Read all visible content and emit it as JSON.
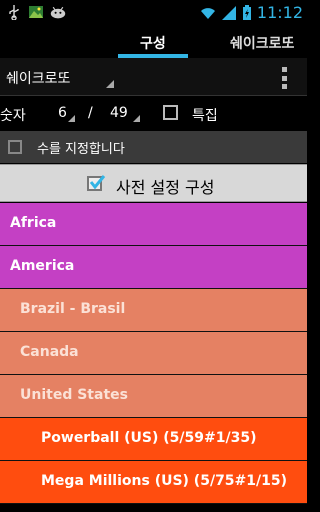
{
  "status_bar": {
    "time": "11:12",
    "left_icons": [
      "usb-icon",
      "image-icon",
      "android-icon"
    ],
    "right_icons": [
      "wifi-icon",
      "signal-icon",
      "battery-icon"
    ]
  },
  "tabs": [
    {
      "label": "구성",
      "active": true
    },
    {
      "label": "쉐이크로또",
      "active": false
    }
  ],
  "spinner": {
    "value": "쉐이크로또"
  },
  "count_row": {
    "label": "숫자",
    "pick": "6",
    "separator": "/",
    "total": "49",
    "special_label": "특집",
    "special_checked": false
  },
  "designate": {
    "label": "수를 지정합니다",
    "checked": false
  },
  "preset": {
    "label": "사전 설정 구성",
    "checked": true
  },
  "list_items": [
    {
      "label": "Africa",
      "level": 0
    },
    {
      "label": "America",
      "level": 0
    },
    {
      "label": "Brazil - Brasil",
      "level": 1
    },
    {
      "label": "Canada",
      "level": 1
    },
    {
      "label": "United States",
      "level": 1
    },
    {
      "label": "Powerball (US) (5/59#1/35)",
      "level": 2
    },
    {
      "label": "Mega Millions (US) (5/75#1/15)",
      "level": 2
    }
  ],
  "colors": {
    "accent": "#33b5e5",
    "level0": "#c440c4",
    "level1": "#e58163",
    "level2": "#ff4d0f"
  }
}
